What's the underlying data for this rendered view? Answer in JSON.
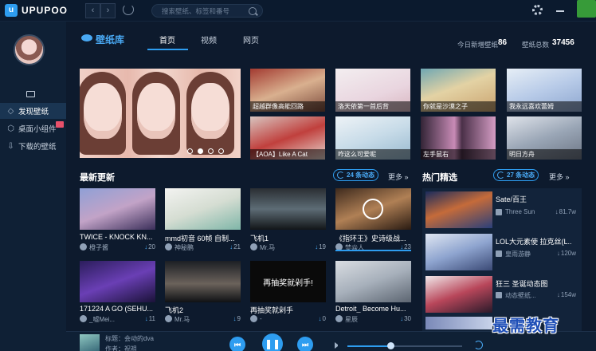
{
  "app": {
    "logo_text": "UPUPOO"
  },
  "search": {
    "placeholder": "搜索壁纸、标签和番号"
  },
  "sidebar": {
    "items": [
      {
        "label": "发现壁纸",
        "icon": "compass-icon"
      },
      {
        "label": "桌面小组件",
        "icon": "widget-icon"
      },
      {
        "label": "下载的壁纸",
        "icon": "download-icon"
      }
    ]
  },
  "header": {
    "brand": "壁纸库",
    "tabs": [
      "首页",
      "视频",
      "网页"
    ],
    "today_label": "今日新增壁纸",
    "today_value": "86",
    "total_label": "壁纸总数",
    "total_value": "37456"
  },
  "featured": [
    {
      "caption": "超越群像高能回路"
    },
    {
      "caption": "洛天依第一首后背"
    },
    {
      "caption": "你就是沙漠之子"
    },
    {
      "caption": "我永远喜欢蕾姆"
    },
    {
      "caption": "【AOA】Like A Cat"
    },
    {
      "caption": "咋这么可爱呢"
    },
    {
      "caption": "左手鼠右"
    },
    {
      "caption": "明日方舟"
    }
  ],
  "latest": {
    "title": "最新更新",
    "pill": "24 条动态",
    "more": "更多",
    "cards": [
      {
        "title": "TWICE - KNOCK KN...",
        "author": "橙子酱",
        "count": "20"
      },
      {
        "title": "mmd初音 60帧 自制...",
        "author": "神秘鹏",
        "count": "21"
      },
      {
        "title": "飞机1",
        "author": "Mr.马",
        "count": "19"
      },
      {
        "title": "《指环王》史诗级战...",
        "author": "焚焱人",
        "count": "23"
      },
      {
        "title": "171224 A GO (SEHU...",
        "author": "_嘘Mei...",
        "count": "11"
      },
      {
        "title": "飞机2",
        "author": "Mr.马",
        "count": "9"
      },
      {
        "title": "再抽奖就剁手",
        "author": "-",
        "count": "0"
      },
      {
        "title": "Detroit_ Become Hu...",
        "author": "星辰",
        "count": "30"
      }
    ],
    "card7_overlay": "再抽奖就剁手!"
  },
  "hot": {
    "title": "热门精选",
    "pill": "27 条动态",
    "more": "更多",
    "items": [
      {
        "title": "Sate/百王",
        "author": "Three Sun",
        "count": "81.7w"
      },
      {
        "title": "LOL大元素使 拉克丝(L...",
        "author": "皇雨游静",
        "count": "120w"
      },
      {
        "title": "狂三 圣诞动态图",
        "author": "动态壁纸...",
        "count": "154w"
      }
    ]
  },
  "player": {
    "title": "标题：会动的dva",
    "author": "作者：祝祖"
  },
  "watermark": "最需教育"
}
